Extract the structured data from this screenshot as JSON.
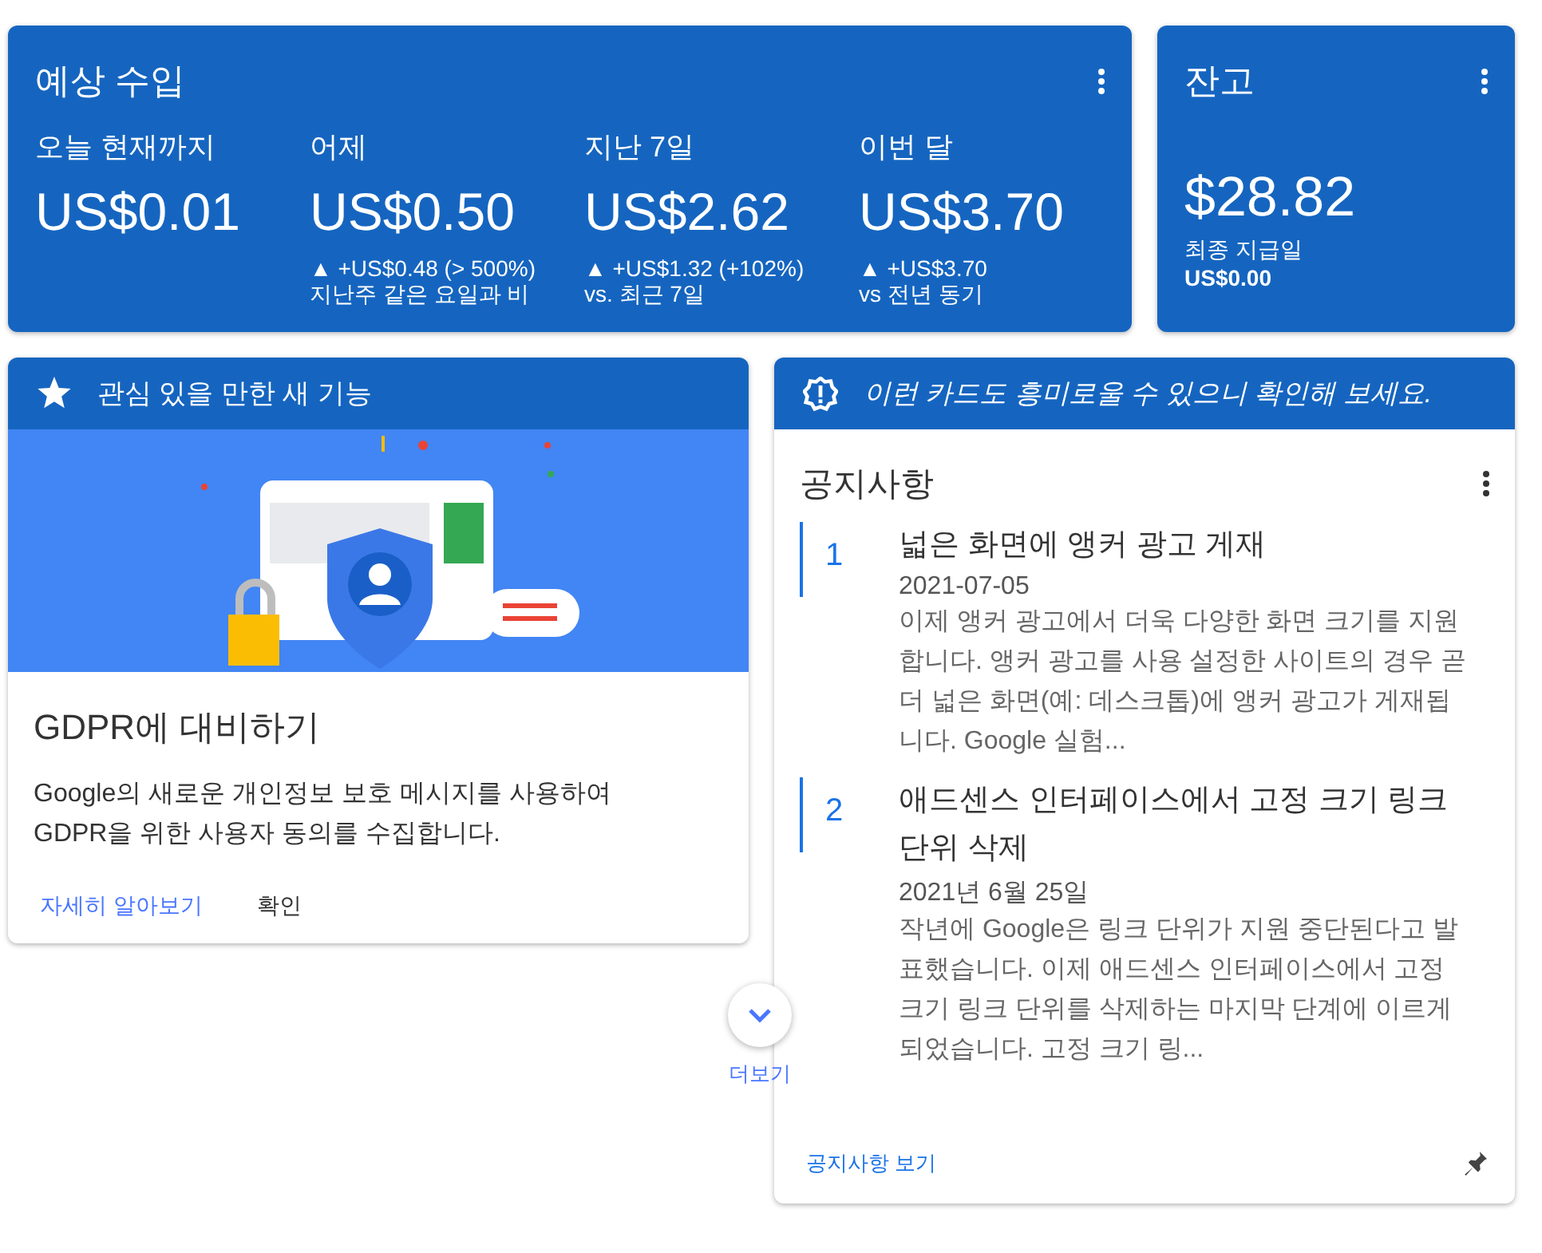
{
  "earnings": {
    "title": "예상 수입",
    "metrics": [
      {
        "label": "오늘 현재까지",
        "value": "US$0.01"
      },
      {
        "label": "어제",
        "value": "US$0.50",
        "change": "▲ +US$0.48 (> 500%)",
        "comparison": "지난주 같은 요일과 비"
      },
      {
        "label": "지난 7일",
        "value": "US$2.62",
        "change": "▲ +US$1.32 (+102%)",
        "comparison": "vs. 최근 7일"
      },
      {
        "label": "이번 달",
        "value": "US$3.70",
        "change": "▲ +US$3.70",
        "comparison": "vs 전년 동기"
      }
    ]
  },
  "balance": {
    "title": "잔고",
    "value": "$28.82",
    "label": "최종 지급일",
    "amount": "US$0.00"
  },
  "feature_card": {
    "header": "관심 있을 만한 새 기능",
    "title": "GDPR에 대비하기",
    "body": "Google의 새로운 개인정보 보호 메시지를 사용하여 GDPR을 위한 사용자 동의를 수집합니다.",
    "actions": [
      {
        "label": "자세히 알아보기",
        "kind": "link"
      },
      {
        "label": "확인",
        "kind": "plain"
      }
    ]
  },
  "more": {
    "label": "더보기"
  },
  "notice_card": {
    "header": "이런 카드도 흥미로울 수 있으니 확인해 보세요.",
    "title": "공지사항",
    "items": [
      {
        "number": "1",
        "title": "넓은 화면에 앵커 광고 게재",
        "date": "2021-07-05",
        "body": "이제 앵커 광고에서 더욱 다양한 화면 크기를 지원합니다. 앵커 광고를 사용 설정한 사이트의 경우 곧 더 넓은 화면(예: 데스크톱)에 앵커 광고가 게재됩니다. Google 실험..."
      },
      {
        "number": "2",
        "title": "애드센스 인터페이스에서 고정 크기 링크 단위 삭제",
        "date": "2021년 6월 25일",
        "body": "작년에 Google은 링크 단위가 지원 중단된다고 발표했습니다. 이제 애드센스 인터페이스에서 고정 크기 링크 단위를 삭제하는 마지막 단계에 이르게 되었습니다. 고정 크기 링..."
      }
    ],
    "link": "공지사항 보기"
  }
}
